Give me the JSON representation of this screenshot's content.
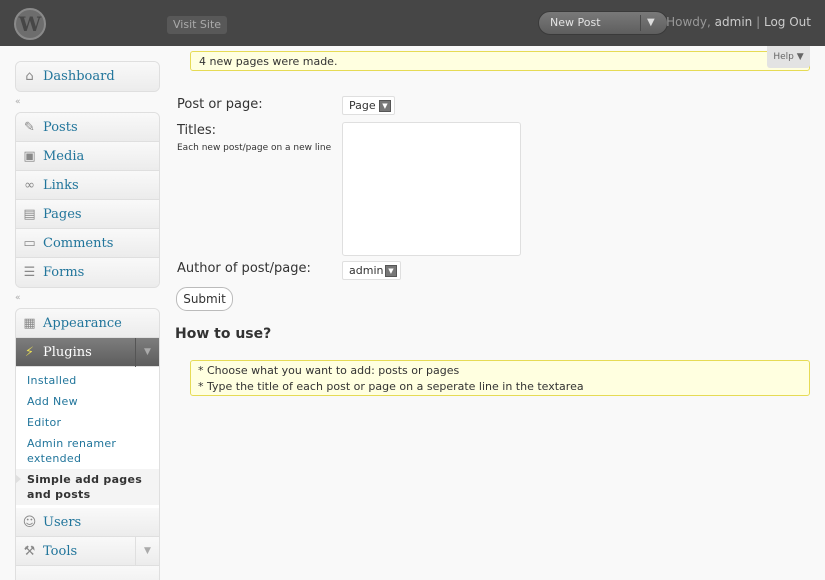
{
  "header": {
    "logo": "W",
    "visit_site": "Visit Site",
    "new_post": "New Post",
    "new_post_arrow": "▼",
    "howdy_prefix": "Howdy,",
    "username": "admin",
    "separator": "|",
    "logout": "Log Out"
  },
  "sidebar": {
    "dashboard": "Dashboard",
    "posts": "Posts",
    "media": "Media",
    "links": "Links",
    "pages": "Pages",
    "comments": "Comments",
    "forms": "Forms",
    "appearance": "Appearance",
    "plugins": "Plugins",
    "plugins_submenu": [
      "Installed",
      "Add New",
      "Editor",
      "Admin renamer extended",
      "Simple add pages and posts"
    ],
    "users": "Users",
    "tools": "Tools",
    "separator_glyph": "«"
  },
  "notice": "4 new pages were made.",
  "help": "Help ▼",
  "form": {
    "post_or_page_label": "Post or page:",
    "post_or_page_value": "Page",
    "titles_label": "Titles:",
    "titles_note": "Each new post/page on a new line",
    "titles_value": "",
    "author_label": "Author of post/page:",
    "author_value": "admin",
    "submit": "Submit"
  },
  "howto": {
    "heading": "How to use?",
    "lines": [
      "* Choose what you want to add: posts or pages",
      "* Type the title of each post or page on a seperate line in the textarea"
    ]
  }
}
